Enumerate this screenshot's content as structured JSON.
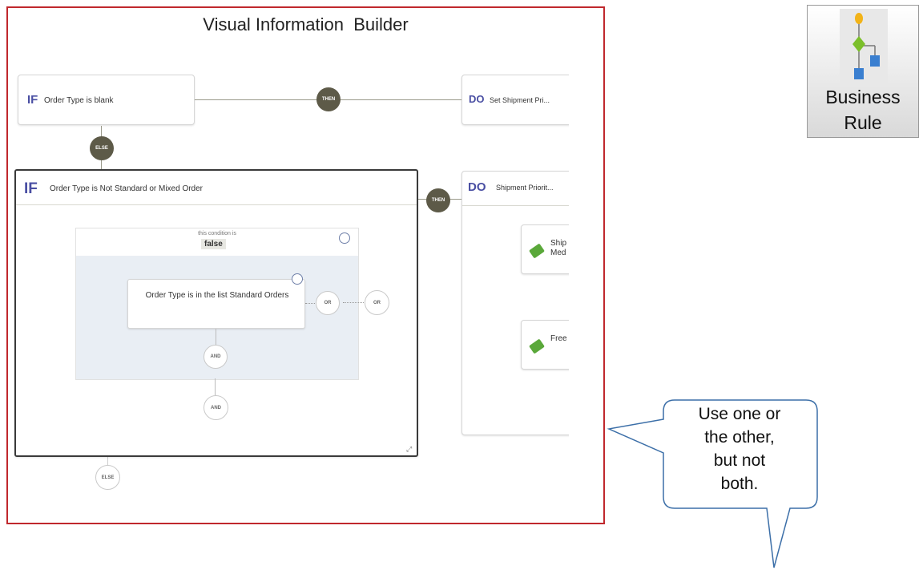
{
  "title": "Visual Information  Builder",
  "rule1": {
    "if_kw": "IF",
    "condition": "Order Type is blank",
    "then": "THEN",
    "do_kw": "DO",
    "action": "Set Shipment Pri..."
  },
  "else1": "ELSE",
  "rule2": {
    "if_kw": "IF",
    "condition": "Order Type is Not Standard or Mixed Order",
    "then": "THEN",
    "do_kw": "DO",
    "action": "Shipment Priorit...",
    "group_caption": "this condition is",
    "group_value": "false",
    "inner_condition": "Order Type is in the list Standard Orders",
    "or1": "OR",
    "or2": "OR",
    "and1": "AND",
    "and2": "AND",
    "action_items": [
      "Ship Med",
      "Free to"
    ]
  },
  "else2": "ELSE",
  "business_rule": {
    "label_line1": "Business",
    "label_line2": "Rule",
    "icon": "flowchart-icon"
  },
  "callout": {
    "line1": "Use one or",
    "line2": "the other,",
    "line3": "but not",
    "line4": "both."
  },
  "colors": {
    "frame": "#c0282d",
    "keyword": "#4a4fa3",
    "pill": "#5d5a48",
    "callout_border": "#3c6fa8",
    "tag": "#5aa83a"
  }
}
